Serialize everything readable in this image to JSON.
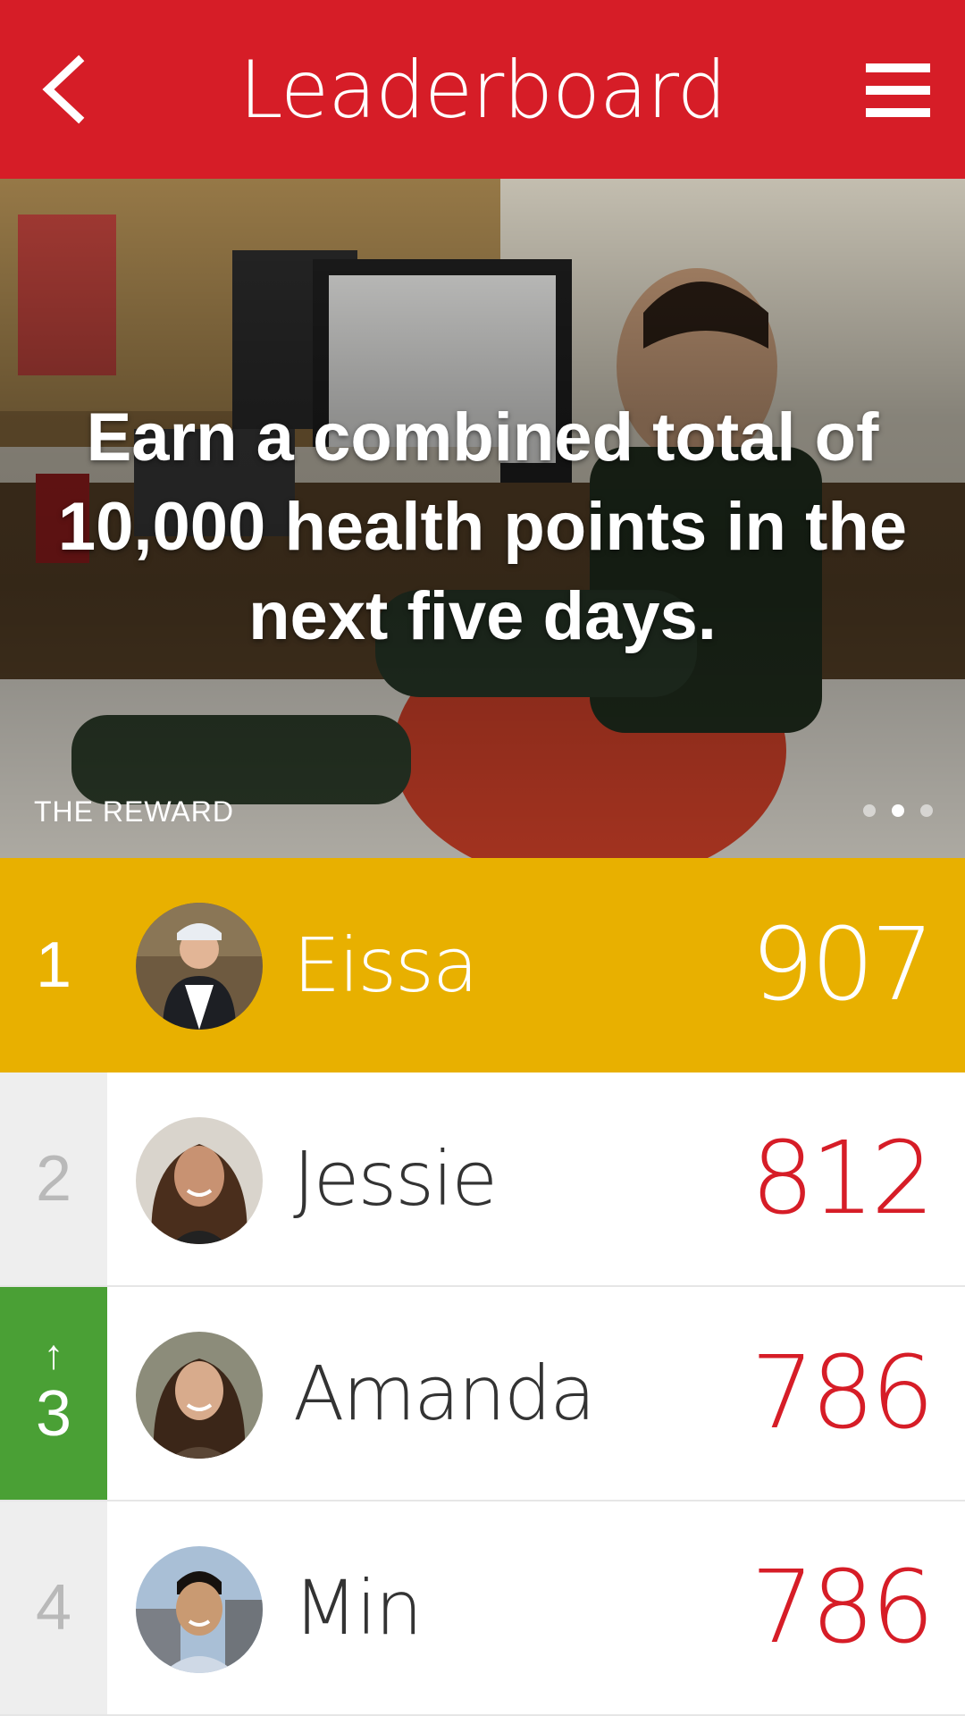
{
  "header": {
    "title": "Leaderboard",
    "back_icon": "chevron-left-icon",
    "menu_icon": "hamburger-menu-icon"
  },
  "hero": {
    "headline": "Earn a combined total of 10,000 health points in the next five days.",
    "label": "THE REWARD",
    "pagination": {
      "count": 3,
      "active_index": 1
    }
  },
  "leaderboard": [
    {
      "rank": "1",
      "name": "Eissa",
      "score": "907",
      "highlight": true,
      "trend": ""
    },
    {
      "rank": "2",
      "name": "Jessie",
      "score": "812",
      "highlight": false,
      "trend": ""
    },
    {
      "rank": "3",
      "name": "Amanda",
      "score": "786",
      "highlight": false,
      "trend": "↑"
    },
    {
      "rank": "4",
      "name": "Min",
      "score": "786",
      "highlight": false,
      "trend": ""
    }
  ],
  "colors": {
    "brand_red": "#d61d27",
    "gold": "#e8b000",
    "up_green": "#4aa035",
    "rank_gray_bg": "#eeeeee"
  }
}
